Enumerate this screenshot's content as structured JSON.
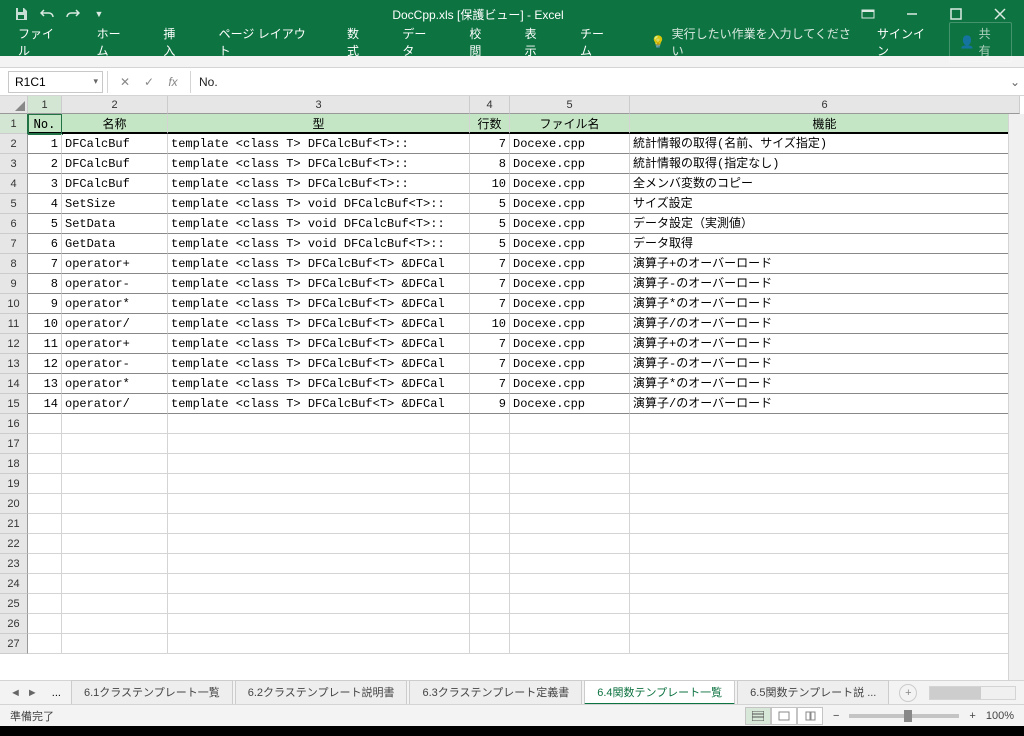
{
  "title": "DocCpp.xls [保護ビュー] - Excel",
  "ribbon": {
    "tabs": [
      "ファイル",
      "ホーム",
      "挿入",
      "ページ レイアウト",
      "数式",
      "データ",
      "校閲",
      "表示",
      "チーム"
    ],
    "tell_me": "実行したい作業を入力してください",
    "signin": "サインイン",
    "share": "共有"
  },
  "name_box": "R1C1",
  "formula": "No.",
  "col_numbers": [
    "1",
    "2",
    "3",
    "4",
    "5",
    "6"
  ],
  "headers": [
    "No.",
    "名称",
    "型",
    "行数",
    "ファイル名",
    "機能"
  ],
  "rows": [
    {
      "no": "1",
      "name": "DFCalcBuf",
      "type": "template <class T> DFCalcBuf<T>::",
      "lines": "7",
      "file": "Docexe.cpp",
      "func": "統計情報の取得(名前、サイズ指定)"
    },
    {
      "no": "2",
      "name": "DFCalcBuf",
      "type": "template <class T> DFCalcBuf<T>::",
      "lines": "8",
      "file": "Docexe.cpp",
      "func": "統計情報の取得(指定なし)"
    },
    {
      "no": "3",
      "name": "DFCalcBuf",
      "type": "template <class T> DFCalcBuf<T>::",
      "lines": "10",
      "file": "Docexe.cpp",
      "func": "全メンバ変数のコピー"
    },
    {
      "no": "4",
      "name": "SetSize",
      "type": "template <class T> void DFCalcBuf<T>::",
      "lines": "5",
      "file": "Docexe.cpp",
      "func": "サイズ設定"
    },
    {
      "no": "5",
      "name": "SetData",
      "type": "template <class T> void DFCalcBuf<T>::",
      "lines": "5",
      "file": "Docexe.cpp",
      "func": "データ設定（実測値）"
    },
    {
      "no": "6",
      "name": "GetData",
      "type": "template <class T> void DFCalcBuf<T>::",
      "lines": "5",
      "file": "Docexe.cpp",
      "func": "データ取得"
    },
    {
      "no": "7",
      "name": "operator+",
      "type": "template <class T> DFCalcBuf<T> &DFCal",
      "lines": "7",
      "file": "Docexe.cpp",
      "func": "演算子+のオーバーロード"
    },
    {
      "no": "8",
      "name": "operator-",
      "type": "template <class T> DFCalcBuf<T> &DFCal",
      "lines": "7",
      "file": "Docexe.cpp",
      "func": "演算子-のオーバーロード"
    },
    {
      "no": "9",
      "name": "operator*",
      "type": "template <class T> DFCalcBuf<T> &DFCal",
      "lines": "7",
      "file": "Docexe.cpp",
      "func": "演算子*のオーバーロード"
    },
    {
      "no": "10",
      "name": "operator/",
      "type": "template <class T> DFCalcBuf<T> &DFCal",
      "lines": "10",
      "file": "Docexe.cpp",
      "func": "演算子/のオーバーロード"
    },
    {
      "no": "11",
      "name": "operator+",
      "type": "template <class T> DFCalcBuf<T> &DFCal",
      "lines": "7",
      "file": "Docexe.cpp",
      "func": "演算子+のオーバーロード"
    },
    {
      "no": "12",
      "name": "operator-",
      "type": "template <class T> DFCalcBuf<T> &DFCal",
      "lines": "7",
      "file": "Docexe.cpp",
      "func": "演算子-のオーバーロード"
    },
    {
      "no": "13",
      "name": "operator*",
      "type": "template <class T> DFCalcBuf<T> &DFCal",
      "lines": "7",
      "file": "Docexe.cpp",
      "func": "演算子*のオーバーロード"
    },
    {
      "no": "14",
      "name": "operator/",
      "type": "template <class T> DFCalcBuf<T> &DFCal",
      "lines": "9",
      "file": "Docexe.cpp",
      "func": "演算子/のオーバーロード"
    }
  ],
  "sheet_tabs": {
    "ellipsis": "...",
    "tabs": [
      "6.1クラステンプレート一覧",
      "6.2クラステンプレート説明書",
      "6.3クラステンプレート定義書",
      "6.4関数テンプレート一覧",
      "6.5関数テンプレート説 ..."
    ],
    "active": 3
  },
  "status": {
    "ready": "準備完了",
    "zoom": "100%"
  }
}
